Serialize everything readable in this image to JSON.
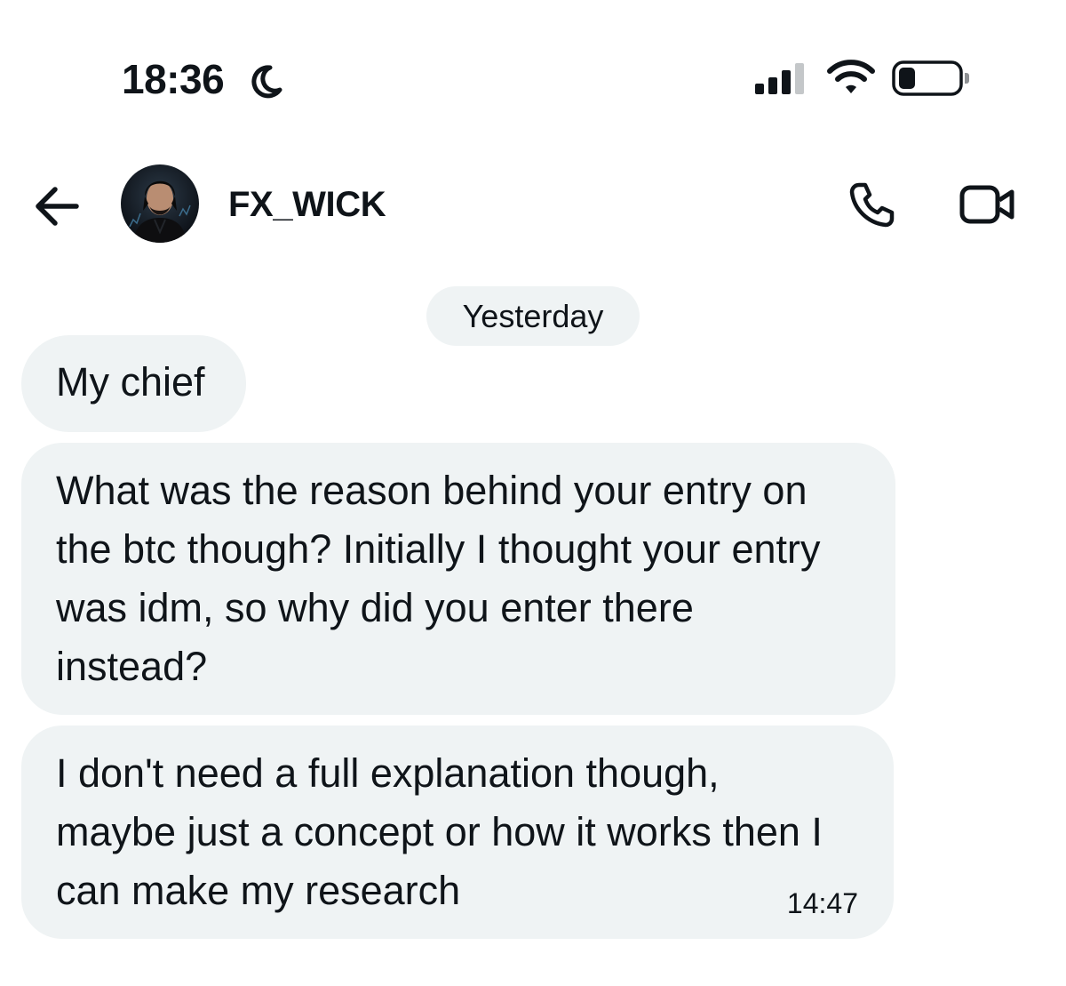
{
  "status_bar": {
    "time": "18:36",
    "icons": [
      "moon-icon",
      "cellular-signal-icon",
      "wifi-icon",
      "battery-icon"
    ]
  },
  "header": {
    "contact_name": "FX_WICK",
    "icons": [
      "back-arrow-icon",
      "avatar",
      "phone-icon",
      "video-camera-icon"
    ]
  },
  "conversation": {
    "date_divider": "Yesterday",
    "messages": [
      {
        "lines": [
          "My chief"
        ],
        "time": ""
      },
      {
        "lines": [
          "What was the reason behind your entry on",
          "the btc though? Initially I thought your entry",
          "was idm, so why did you enter there",
          "instead?"
        ],
        "time": ""
      },
      {
        "lines": [
          "I don't need a full explanation though,",
          "maybe just a concept or how it works then I",
          "can make my research"
        ],
        "time": "14:47"
      }
    ]
  },
  "colors": {
    "bubble_bg": "#eff3f4",
    "text": "#0f1419",
    "background": "#ffffff"
  }
}
